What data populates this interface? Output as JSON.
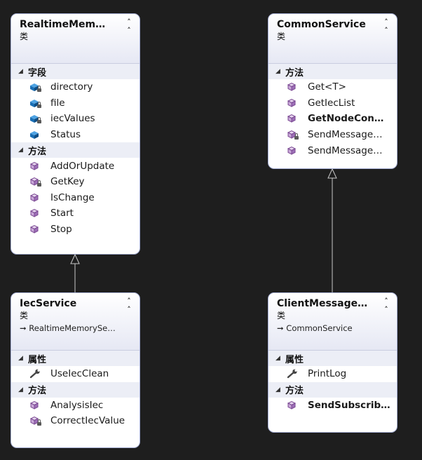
{
  "colors": {
    "canvas": "#1e1e1e",
    "connector": "#c8c8c8",
    "box_border": "#a7b0d6"
  },
  "icons": {
    "collapse": "double-chevron-up",
    "section": "triangle-down",
    "field": "field-cube",
    "method": "method-cube",
    "property": "wrench",
    "inherit": "arrow-right"
  },
  "classes": [
    {
      "title": "RealtimeMem…",
      "kind": "类",
      "sections": [
        {
          "label": "字段",
          "items": [
            {
              "name": "directory",
              "icon": "field",
              "private": true
            },
            {
              "name": "file",
              "icon": "field",
              "private": true
            },
            {
              "name": "iecValues",
              "icon": "field",
              "private": true
            },
            {
              "name": "Status",
              "icon": "field",
              "private": false
            }
          ]
        },
        {
          "label": "方法",
          "items": [
            {
              "name": "AddOrUpdate",
              "icon": "method",
              "private": false
            },
            {
              "name": "GetKey",
              "icon": "method",
              "private": true
            },
            {
              "name": "IsChange",
              "icon": "method",
              "private": false
            },
            {
              "name": "Start",
              "icon": "method",
              "private": false
            },
            {
              "name": "Stop",
              "icon": "method",
              "private": false
            }
          ]
        }
      ]
    },
    {
      "title": "CommonService",
      "kind": "类",
      "sections": [
        {
          "label": "方法",
          "items": [
            {
              "name": "Get<T>",
              "icon": "method",
              "private": false
            },
            {
              "name": "GetIecList",
              "icon": "method",
              "private": false
            },
            {
              "name": "GetNodeCon…",
              "icon": "method",
              "private": false,
              "bold": true
            },
            {
              "name": "SendMessage…",
              "icon": "method",
              "private": true
            },
            {
              "name": "SendMessage…",
              "icon": "method",
              "private": false
            }
          ]
        }
      ]
    },
    {
      "title": "IecService",
      "kind": "类",
      "base": "RealtimeMemorySe…",
      "sections": [
        {
          "label": "属性",
          "items": [
            {
              "name": "UseIecClean",
              "icon": "property",
              "private": false
            }
          ]
        },
        {
          "label": "方法",
          "items": [
            {
              "name": "AnalysisIec",
              "icon": "method",
              "private": false
            },
            {
              "name": "CorrectIecValue",
              "icon": "method",
              "private": true
            }
          ]
        }
      ]
    },
    {
      "title": "ClientMessage…",
      "kind": "类",
      "base": "CommonService",
      "sections": [
        {
          "label": "属性",
          "items": [
            {
              "name": "PrintLog",
              "icon": "property",
              "private": false
            }
          ]
        },
        {
          "label": "方法",
          "items": [
            {
              "name": "SendSubscrib…",
              "icon": "method",
              "private": false,
              "bold": true
            }
          ]
        }
      ]
    }
  ]
}
